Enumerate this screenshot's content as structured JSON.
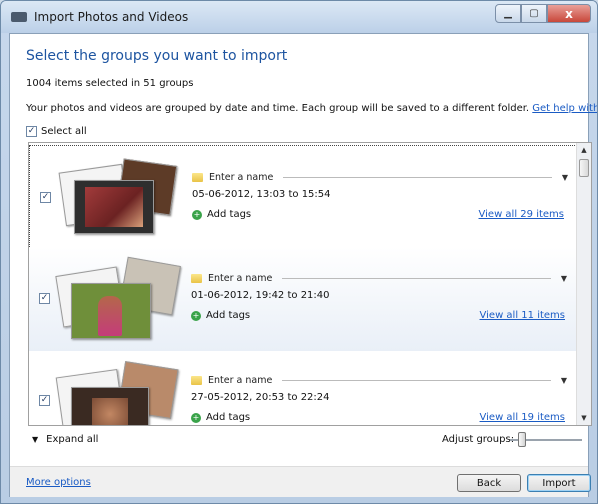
{
  "window": {
    "title": "Import Photos and Videos",
    "close_glyph": "x"
  },
  "header": {
    "heading": "Select the groups you want to import",
    "count": "1004 items selected in 51 groups",
    "description": "Your photos and videos are grouped by date and time. Each group will be saved to a different folder.",
    "help_link": "Get help with this",
    "select_all": "Select all"
  },
  "groups": [
    {
      "name_placeholder": "Enter a name",
      "date": "05-06-2012, 13:03 to 15:54",
      "tags": "Add tags",
      "view_all": "View all 29 items",
      "checked": true
    },
    {
      "name_placeholder": "Enter a name",
      "date": "01-06-2012, 19:42 to 21:40",
      "tags": "Add tags",
      "view_all": "View all 11 items",
      "checked": true
    },
    {
      "name_placeholder": "Enter a name",
      "date": "27-05-2012, 20:53 to 22:24",
      "tags": "Add tags",
      "view_all": "View all 19 items",
      "checked": true
    }
  ],
  "controls": {
    "expand_all": "Expand all",
    "adjust_groups": "Adjust groups:"
  },
  "footer": {
    "more_options": "More options",
    "back": "Back",
    "import": "Import"
  },
  "colors": {
    "heading": "#1d54a0",
    "link": "#1a5bc4"
  },
  "icons": {
    "folder": "folder-icon",
    "tag": "add-tag-icon",
    "check": "✓"
  }
}
